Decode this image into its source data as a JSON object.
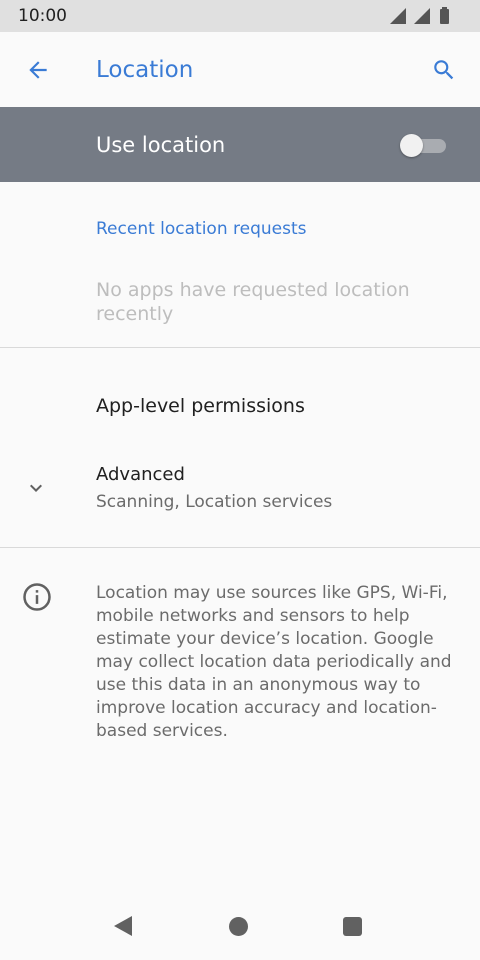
{
  "status_bar": {
    "time": "10:00"
  },
  "app_bar": {
    "title": "Location",
    "back_icon": "arrow-back-icon",
    "search_icon": "search-icon"
  },
  "master_switch": {
    "label": "Use location",
    "checked": false
  },
  "recent_requests": {
    "header": "Recent location requests",
    "empty_text": "No apps have requested location recently"
  },
  "app_permissions": {
    "title": "App-level permissions"
  },
  "advanced": {
    "title": "Advanced",
    "summary": "Scanning, Location services",
    "icon": "chevron-down-icon"
  },
  "footer": {
    "icon": "info-icon",
    "text": "Location may use sources like GPS, Wi-Fi, mobile networks and sensors to help estimate your device’s location. Google may collect location data periodically and use this data in an anonymous way to improve location accuracy and location-based services."
  },
  "colors": {
    "accent": "#3a7bd5",
    "switch_bar_bg": "#757b85"
  }
}
